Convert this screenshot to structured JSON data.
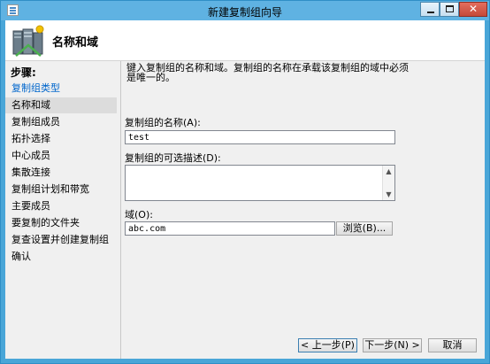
{
  "window": {
    "title": "新建复制组向导",
    "controls": {
      "minimize": "",
      "maximize": "",
      "close": "✕"
    }
  },
  "header": {
    "title": "名称和域",
    "icon": "replication-group-wizard-icon"
  },
  "sidebar": {
    "title": "步骤:",
    "items": [
      {
        "label": "复制组类型",
        "state": "active"
      },
      {
        "label": "名称和域",
        "state": "current"
      },
      {
        "label": "复制组成员",
        "state": ""
      },
      {
        "label": "拓扑选择",
        "state": ""
      },
      {
        "label": "中心成员",
        "state": ""
      },
      {
        "label": "集散连接",
        "state": ""
      },
      {
        "label": "复制组计划和带宽",
        "state": ""
      },
      {
        "label": "主要成员",
        "state": ""
      },
      {
        "label": "要复制的文件夹",
        "state": ""
      },
      {
        "label": "复查设置并创建复制组",
        "state": ""
      },
      {
        "label": "确认",
        "state": ""
      }
    ]
  },
  "content": {
    "description": "键入复制组的名称和域。复制组的名称在承载该复制组的域中必须是唯一的。",
    "name_label": "复制组的名称(A):",
    "name_value": "test",
    "desc_label": "复制组的可选描述(D):",
    "desc_value": "",
    "domain_label": "域(O):",
    "domain_value": "abc.com",
    "browse_label": "浏览(B)..."
  },
  "footer": {
    "back_label": "< 上一步(P)",
    "next_label": "下一步(N) >",
    "cancel_label": "取消"
  }
}
